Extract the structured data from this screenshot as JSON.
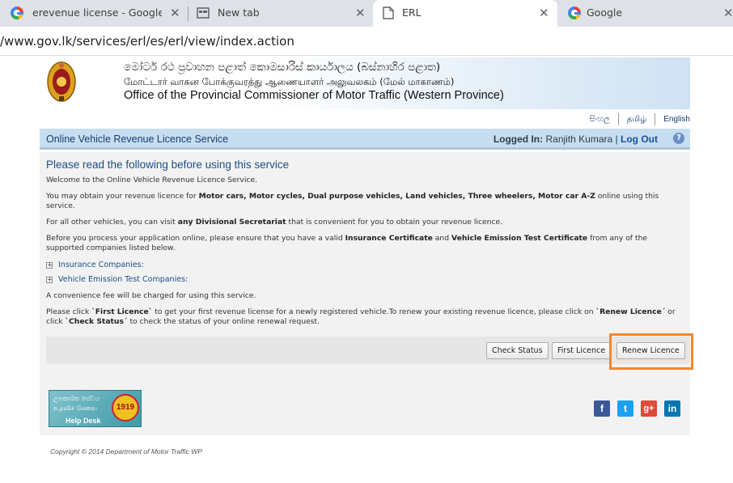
{
  "browser": {
    "tabs": [
      {
        "title": "erevenue license - Google Sear",
        "icon": "google-icon"
      },
      {
        "title": "New tab",
        "icon": "new-tab-icon"
      },
      {
        "title": "ERL",
        "icon": "page-icon"
      },
      {
        "title": "Google",
        "icon": "google-icon"
      }
    ],
    "close_glyph": "✕",
    "url": "/www.gov.lk/services/erl/es/erl/view/index.action"
  },
  "header": {
    "line_sinhala": "මෝටර් රථ ප්‍රවාහන පළාත් කොමසාරිස් කාර්යාලය (බස්නාහිර පළාත)",
    "line_tamil": "மோட்டார் வாகன போக்குவரத்து ஆணையாளர் அலுவலகம் (மேல் மாகாணம்)",
    "line_english": "Office of the Provincial Commissioner of Motor Traffic (Western Province)"
  },
  "languages": [
    "සිංහල",
    "தமிழ்",
    "English"
  ],
  "servicebar": {
    "title": "Online Vehicle Revenue Licence Service",
    "logged_in_label": "Logged In:",
    "user_name": "Ranjith Kumara",
    "separator": "|",
    "logout_label": "Log Out",
    "help_glyph": "?"
  },
  "content": {
    "title": "Please read the following before using this service",
    "welcome": "Welcome to the Online Vehicle Revenue Licence Service.",
    "obtain_prefix": "You may obtain your revenue licence for ",
    "obtain_bold": "Motor cars, Motor cycles, Dual purpose vehicles, Land vehicles, Three wheelers, Motor car A-Z",
    "obtain_suffix": " online using this service.",
    "other_prefix": "For all other vehicles, you can visit ",
    "other_bold": "any Divisional Secretariat",
    "other_suffix": " that is convenient for you to obtain your revenue licence.",
    "before_prefix": "Before you process your application online, please ensure that you have a valid ",
    "before_bold1": "Insurance Certificate",
    "before_mid": " and ",
    "before_bold2": "Vehicle Emission Test Certificate",
    "before_suffix": " from any of the supported companies listed below.",
    "insurance_label": "Insurance Companies:",
    "emission_label": "Vehicle Emission Test Companies:",
    "fee_note": "A convenience fee will be charged for using this service.",
    "click_p1": "Please click ",
    "click_b1": "`First Licence`",
    "click_p2": " to get your first revenue license for a newly registered vehicle.To renew your existing revenue licence, please click on ",
    "click_b2": "`Renew Licence´",
    "click_p3": " or click ",
    "click_b3": "`Check Status´",
    "click_p4": " to check the status of your online renewal request."
  },
  "buttons": {
    "check_status": "Check Status",
    "first_licence": "First Licence",
    "renew_licence": "Renew Licence"
  },
  "helpdesk": {
    "line1": "උපකාරක සේවය",
    "line2": "உதவிச் சேவை",
    "label": "Help Desk",
    "number": "1919"
  },
  "social": {
    "facebook": "f",
    "twitter": "t",
    "google_plus": "g+",
    "linkedin": "in",
    "colors": {
      "facebook": "#3b5998",
      "twitter": "#1da1f2",
      "google_plus": "#dd4b39",
      "linkedin": "#0077b5"
    }
  },
  "footer": "Copyright © 2014 Department of Motor Traffic WP",
  "colors": {
    "highlight": "#f3872f",
    "link": "#1a4f8a"
  }
}
